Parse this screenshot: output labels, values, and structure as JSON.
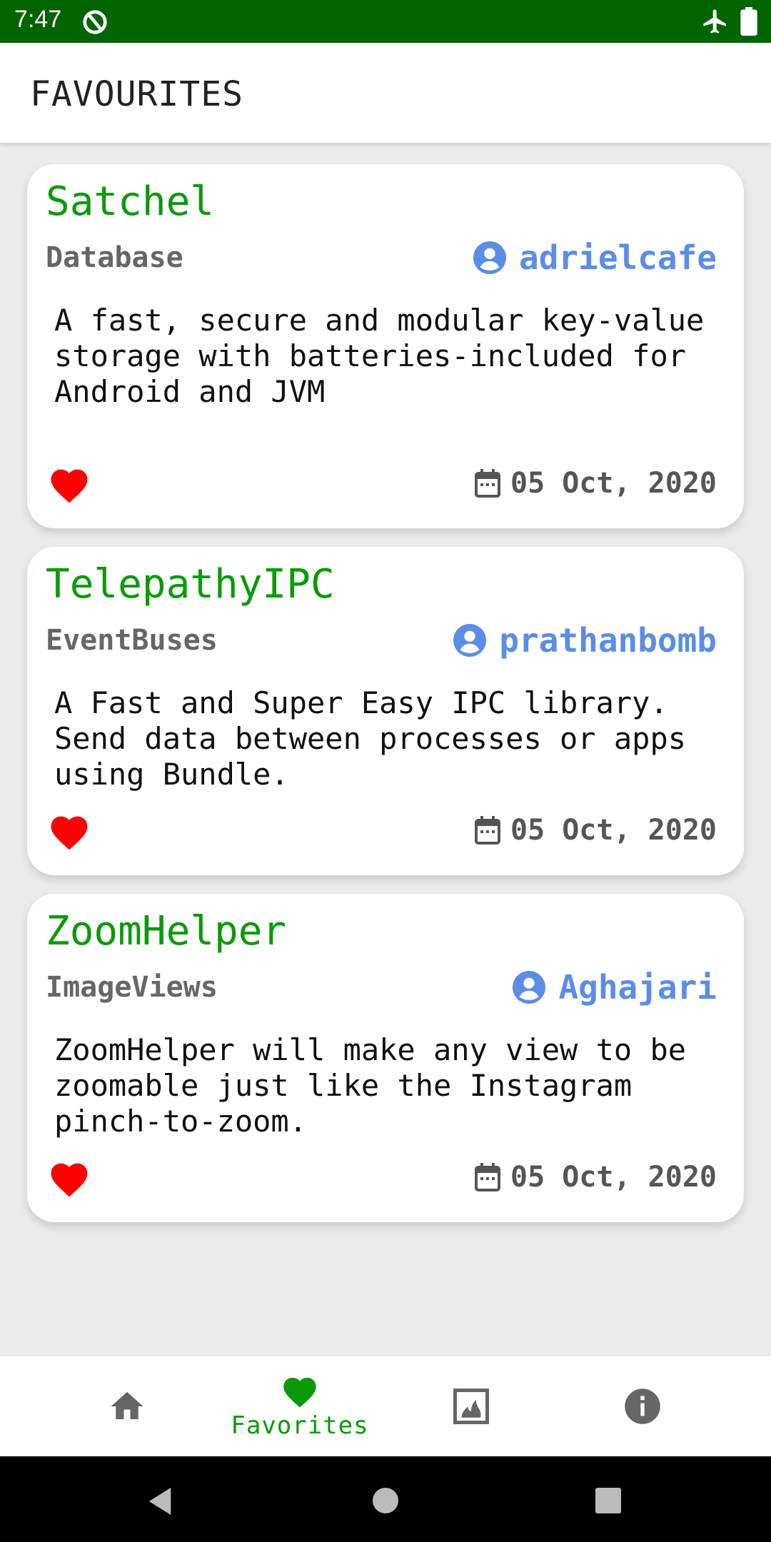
{
  "status_bar": {
    "time": "7:47"
  },
  "app_bar": {
    "title": "FAVOURITES"
  },
  "cards": [
    {
      "title": "Satchel",
      "category": "Database",
      "owner": "adrielcafe",
      "description": "A fast, secure and modular key-value storage with batteries-included for Android and JVM",
      "date": "05 Oct, 2020"
    },
    {
      "title": "TelepathyIPC",
      "category": "EventBuses",
      "owner": "prathanbomb",
      "description": "A Fast and Super Easy IPC library. Send data between processes or apps using Bundle.",
      "date": "05 Oct, 2020"
    },
    {
      "title": "ZoomHelper",
      "category": "ImageViews",
      "owner": "Aghajari",
      "description": "ZoomHelper will make any view to be zoomable just like the Instagram pinch-to-zoom.",
      "date": "05 Oct, 2020"
    }
  ],
  "bottom_nav": {
    "items": [
      {
        "icon": "home-icon"
      },
      {
        "icon": "heart-icon",
        "label": "Favorites",
        "active": true
      },
      {
        "icon": "gallery-icon"
      },
      {
        "icon": "info-icon"
      }
    ]
  },
  "colors": {
    "status_bar": "#006400",
    "accent_green": "#0a9a0a",
    "owner_blue": "#5b8de6",
    "heart_red": "#ff0000",
    "background": "#ebebeb"
  }
}
